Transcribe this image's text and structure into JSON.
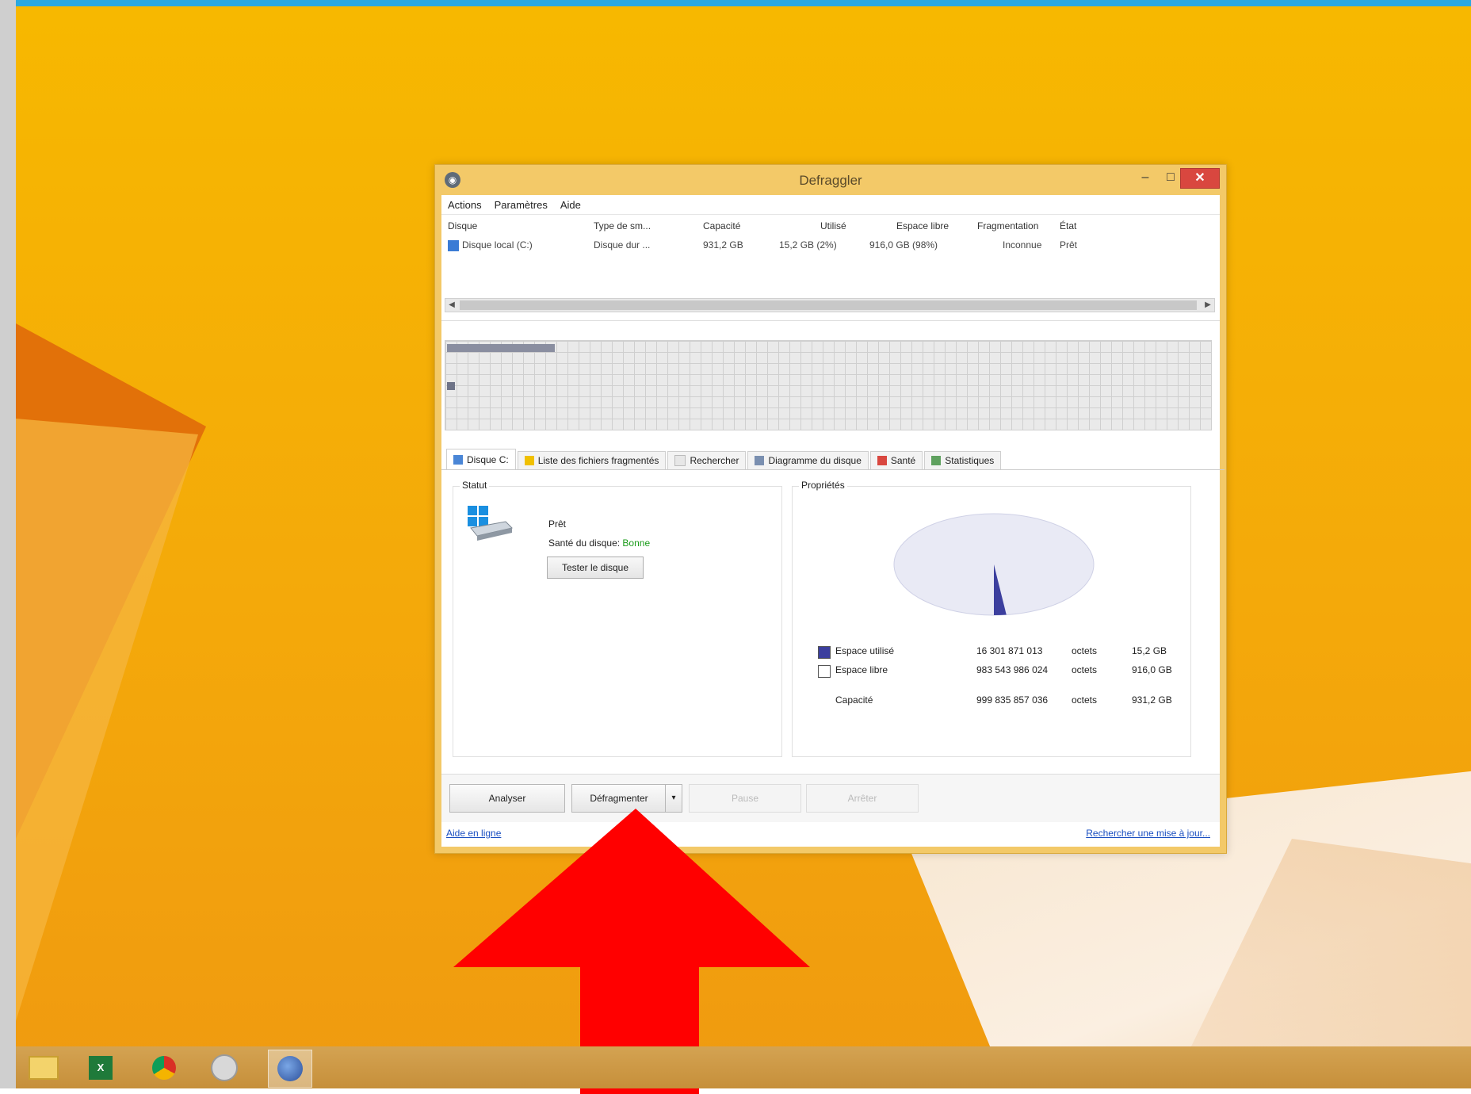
{
  "window": {
    "title": "Defraggler",
    "app_icon": "defraggler-icon",
    "controls": {
      "minimize": "–",
      "maximize": "□",
      "close": "✕"
    }
  },
  "menu": [
    {
      "label": "Actions"
    },
    {
      "label": "Paramètres"
    },
    {
      "label": "Aide"
    }
  ],
  "disk_list": {
    "columns": [
      "Disque",
      "Type de sm...",
      "Capacité",
      "Utilisé",
      "Espace libre",
      "Fragmentation",
      "État"
    ],
    "rows": [
      {
        "disk": "Disque local (C:)",
        "type": "Disque dur ...",
        "capacity": "931,2 GB",
        "used": "15,2 GB (2%)",
        "free": "916,0 GB (98%)",
        "fragmentation": "Inconnue",
        "state": "Prêt"
      }
    ]
  },
  "tabs": [
    {
      "label": "Disque C:",
      "icon": "hdd-icon"
    },
    {
      "label": "Liste des fichiers fragmentés",
      "icon": "warning-icon"
    },
    {
      "label": "Rechercher",
      "icon": "search-icon"
    },
    {
      "label": "Diagramme du disque",
      "icon": "chart-icon"
    },
    {
      "label": "Santé",
      "icon": "health-icon"
    },
    {
      "label": "Statistiques",
      "icon": "stats-icon"
    }
  ],
  "status": {
    "group_title": "Statut",
    "state": "Prêt",
    "health_label": "Santé du disque:",
    "health_value": "Bonne",
    "test_button": "Tester le disque"
  },
  "properties": {
    "group_title": "Propriétés",
    "used": {
      "label": "Espace utilisé",
      "bytes": "16 301 871 013",
      "unit": "octets",
      "size": "15,2 GB"
    },
    "free": {
      "label": "Espace libre",
      "bytes": "983 543 986 024",
      "unit": "octets",
      "size": "916,0 GB"
    },
    "capacity": {
      "label": "Capacité",
      "bytes": "999 835 857 036",
      "unit": "octets",
      "size": "931,2 GB"
    },
    "used_fraction": 0.02,
    "colors": {
      "used": "#3c3f9e",
      "free": "#e9eaf5"
    }
  },
  "buttons": {
    "analyze": "Analyser",
    "defrag": "Défragmenter",
    "defrag_arrow": "▾",
    "pause": "Pause",
    "stop": "Arrêter"
  },
  "links": {
    "help": "Aide en ligne",
    "update": "Rechercher une mise à jour..."
  },
  "taskbar": [
    {
      "name": "file-explorer-icon",
      "glyph": "📁"
    },
    {
      "name": "excel-icon",
      "glyph": "X"
    },
    {
      "name": "chrome-icon",
      "glyph": "●"
    },
    {
      "name": "settings-icon",
      "glyph": "⚙"
    },
    {
      "name": "defraggler-taskbar-icon",
      "glyph": "▣"
    }
  ]
}
